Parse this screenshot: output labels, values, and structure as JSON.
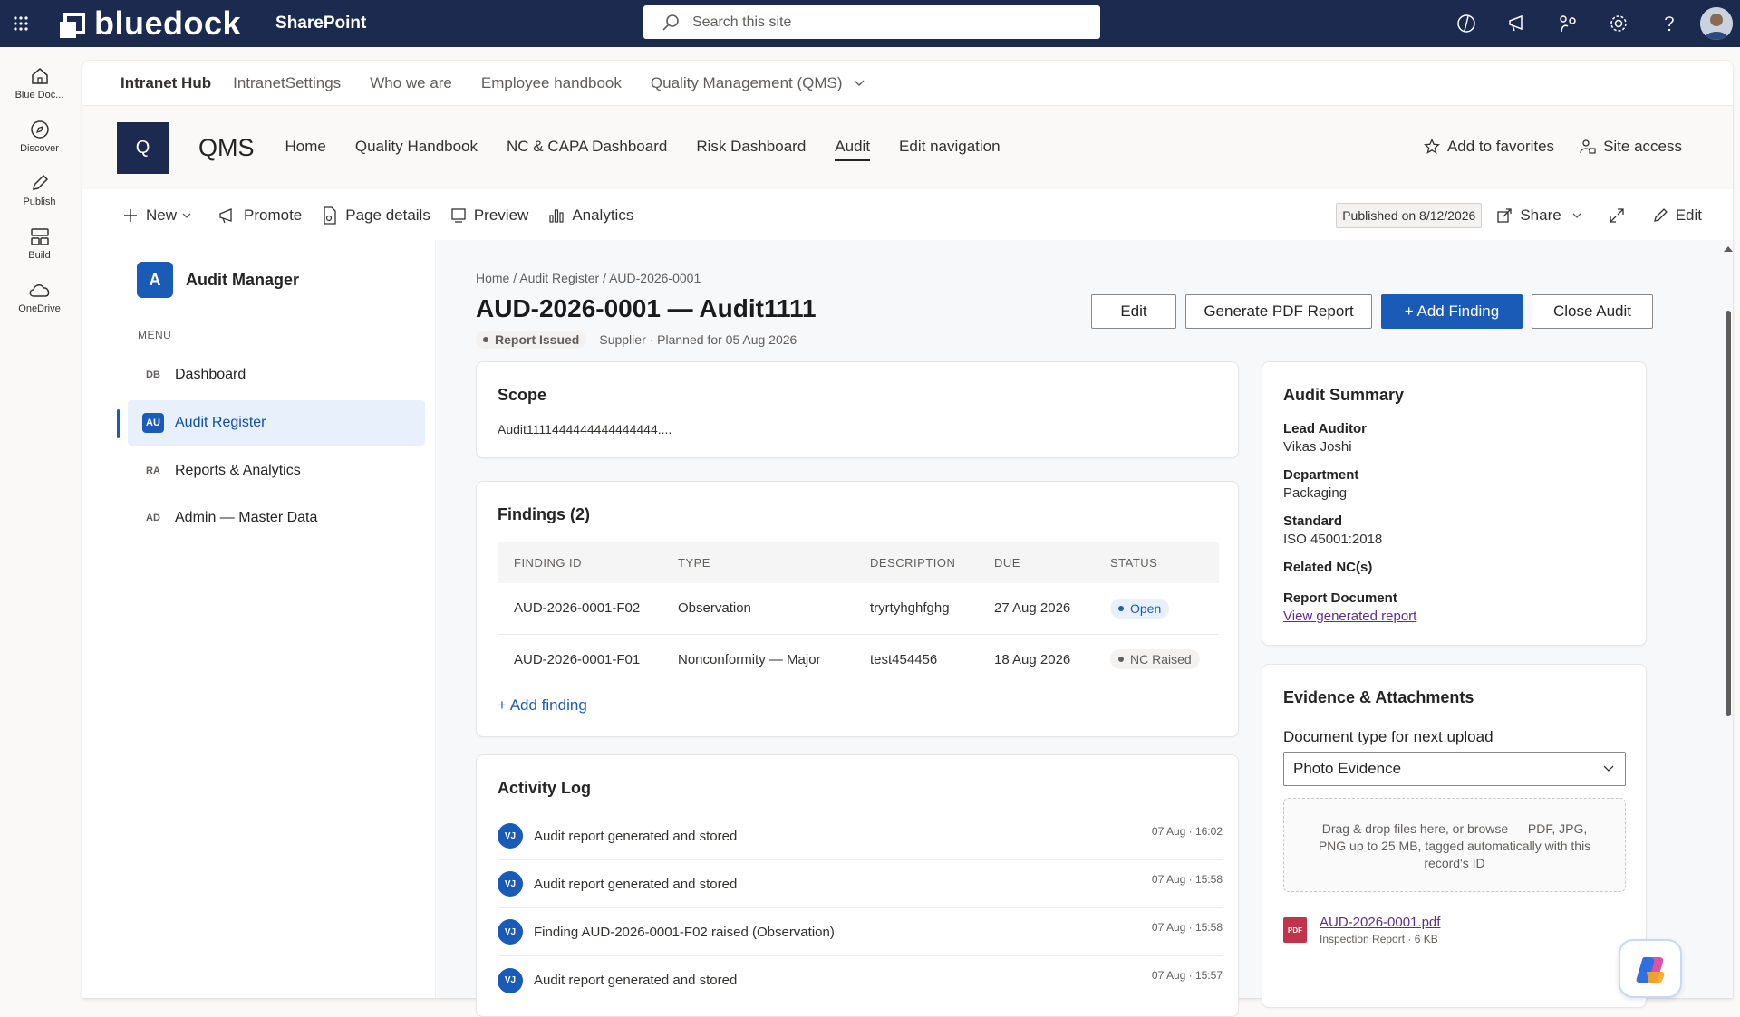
{
  "topbar": {
    "brand": "bluedock",
    "app": "SharePoint",
    "search_placeholder": "Search this site"
  },
  "rail": [
    {
      "label": "Blue Doc...",
      "icon": "home-icon"
    },
    {
      "label": "Discover",
      "icon": "compass-icon"
    },
    {
      "label": "Publish",
      "icon": "pen-icon"
    },
    {
      "label": "Build",
      "icon": "build-icon"
    },
    {
      "label": "OneDrive",
      "icon": "cloud-icon"
    }
  ],
  "hubnav": {
    "title": "Intranet Hub",
    "items": [
      "IntranetSettings",
      "Who we are",
      "Employee handbook",
      "Quality Management (QMS)"
    ]
  },
  "site": {
    "logo_letter": "Q",
    "title": "QMS",
    "nav": [
      "Home",
      "Quality Handbook",
      "NC & CAPA Dashboard",
      "Risk Dashboard",
      "Audit",
      "Edit navigation"
    ],
    "favorites": "Add to favorites",
    "access": "Site access"
  },
  "cmdbar": {
    "new": "New",
    "promote": "Promote",
    "page_details": "Page details",
    "preview": "Preview",
    "analytics": "Analytics",
    "published": "Published on 8/12/2026",
    "share": "Share",
    "edit": "Edit"
  },
  "app": {
    "logo_letter": "A",
    "title": "Audit Manager",
    "menu_label": "MENU",
    "nav": [
      {
        "abbr": "DB",
        "label": "Dashboard"
      },
      {
        "abbr": "AU",
        "label": "Audit Register"
      },
      {
        "abbr": "RA",
        "label": "Reports & Analytics"
      },
      {
        "abbr": "AD",
        "label": "Admin — Master Data"
      }
    ]
  },
  "record": {
    "breadcrumb": "Home / Audit Register / AUD-2026-0001",
    "title": "AUD-2026-0001 — Audit1111",
    "status": "Report Issued",
    "meta": "Supplier · Planned for 05 Aug 2026",
    "buttons": {
      "edit": "Edit",
      "pdf": "Generate PDF Report",
      "add": "+ Add Finding",
      "close": "Close Audit"
    }
  },
  "scope": {
    "title": "Scope",
    "text": "Audit1111444444444444444...."
  },
  "findings": {
    "title": "Findings (2)",
    "columns": [
      "FINDING ID",
      "TYPE",
      "DESCRIPTION",
      "DUE",
      "STATUS"
    ],
    "rows": [
      {
        "id": "AUD-2026-0001-F02",
        "type": "Observation",
        "desc": "tryrtyhghfghg",
        "due": "27 Aug 2026",
        "status": "Open"
      },
      {
        "id": "AUD-2026-0001-F01",
        "type": "Nonconformity — Major",
        "desc": "test454456",
        "due": "18 Aug 2026",
        "status": "NC Raised"
      }
    ],
    "add_link": "+ Add finding"
  },
  "activity": {
    "title": "Activity Log",
    "rows": [
      {
        "initials": "VJ",
        "text": "Audit report generated and stored",
        "time": "07 Aug · 16:02"
      },
      {
        "initials": "VJ",
        "text": "Audit report generated and stored",
        "time": "07 Aug · 15:58"
      },
      {
        "initials": "VJ",
        "text": "Finding AUD-2026-0001-F02 raised (Observation)",
        "time": "07 Aug · 15:58"
      },
      {
        "initials": "VJ",
        "text": "Audit report generated and stored",
        "time": "07 Aug · 15:57"
      }
    ]
  },
  "summary": {
    "title": "Audit Summary",
    "lead_label": "Lead Auditor",
    "lead": "Vikas Joshi",
    "dept_label": "Department",
    "dept": "Packaging",
    "std_label": "Standard",
    "std": "ISO 45001:2018",
    "nc_label": "Related NC(s)",
    "doc_label": "Report Document",
    "doc_link": "View generated report"
  },
  "evidence": {
    "title": "Evidence & Attachments",
    "doctype_label": "Document type for next upload",
    "doctype_value": "Photo Evidence",
    "dropzone": "Drag & drop files here, or browse — PDF, JPG, PNG up to 25 MB, tagged automatically with this record's ID",
    "file_badge": "PDF",
    "file_name": "AUD-2026-0001.pdf",
    "file_meta": "Inspection Report · 6 KB"
  },
  "colors": {
    "topbar": "#1b2a4e",
    "accent": "#1a5bb8",
    "link_visited": "#5c2e91"
  }
}
